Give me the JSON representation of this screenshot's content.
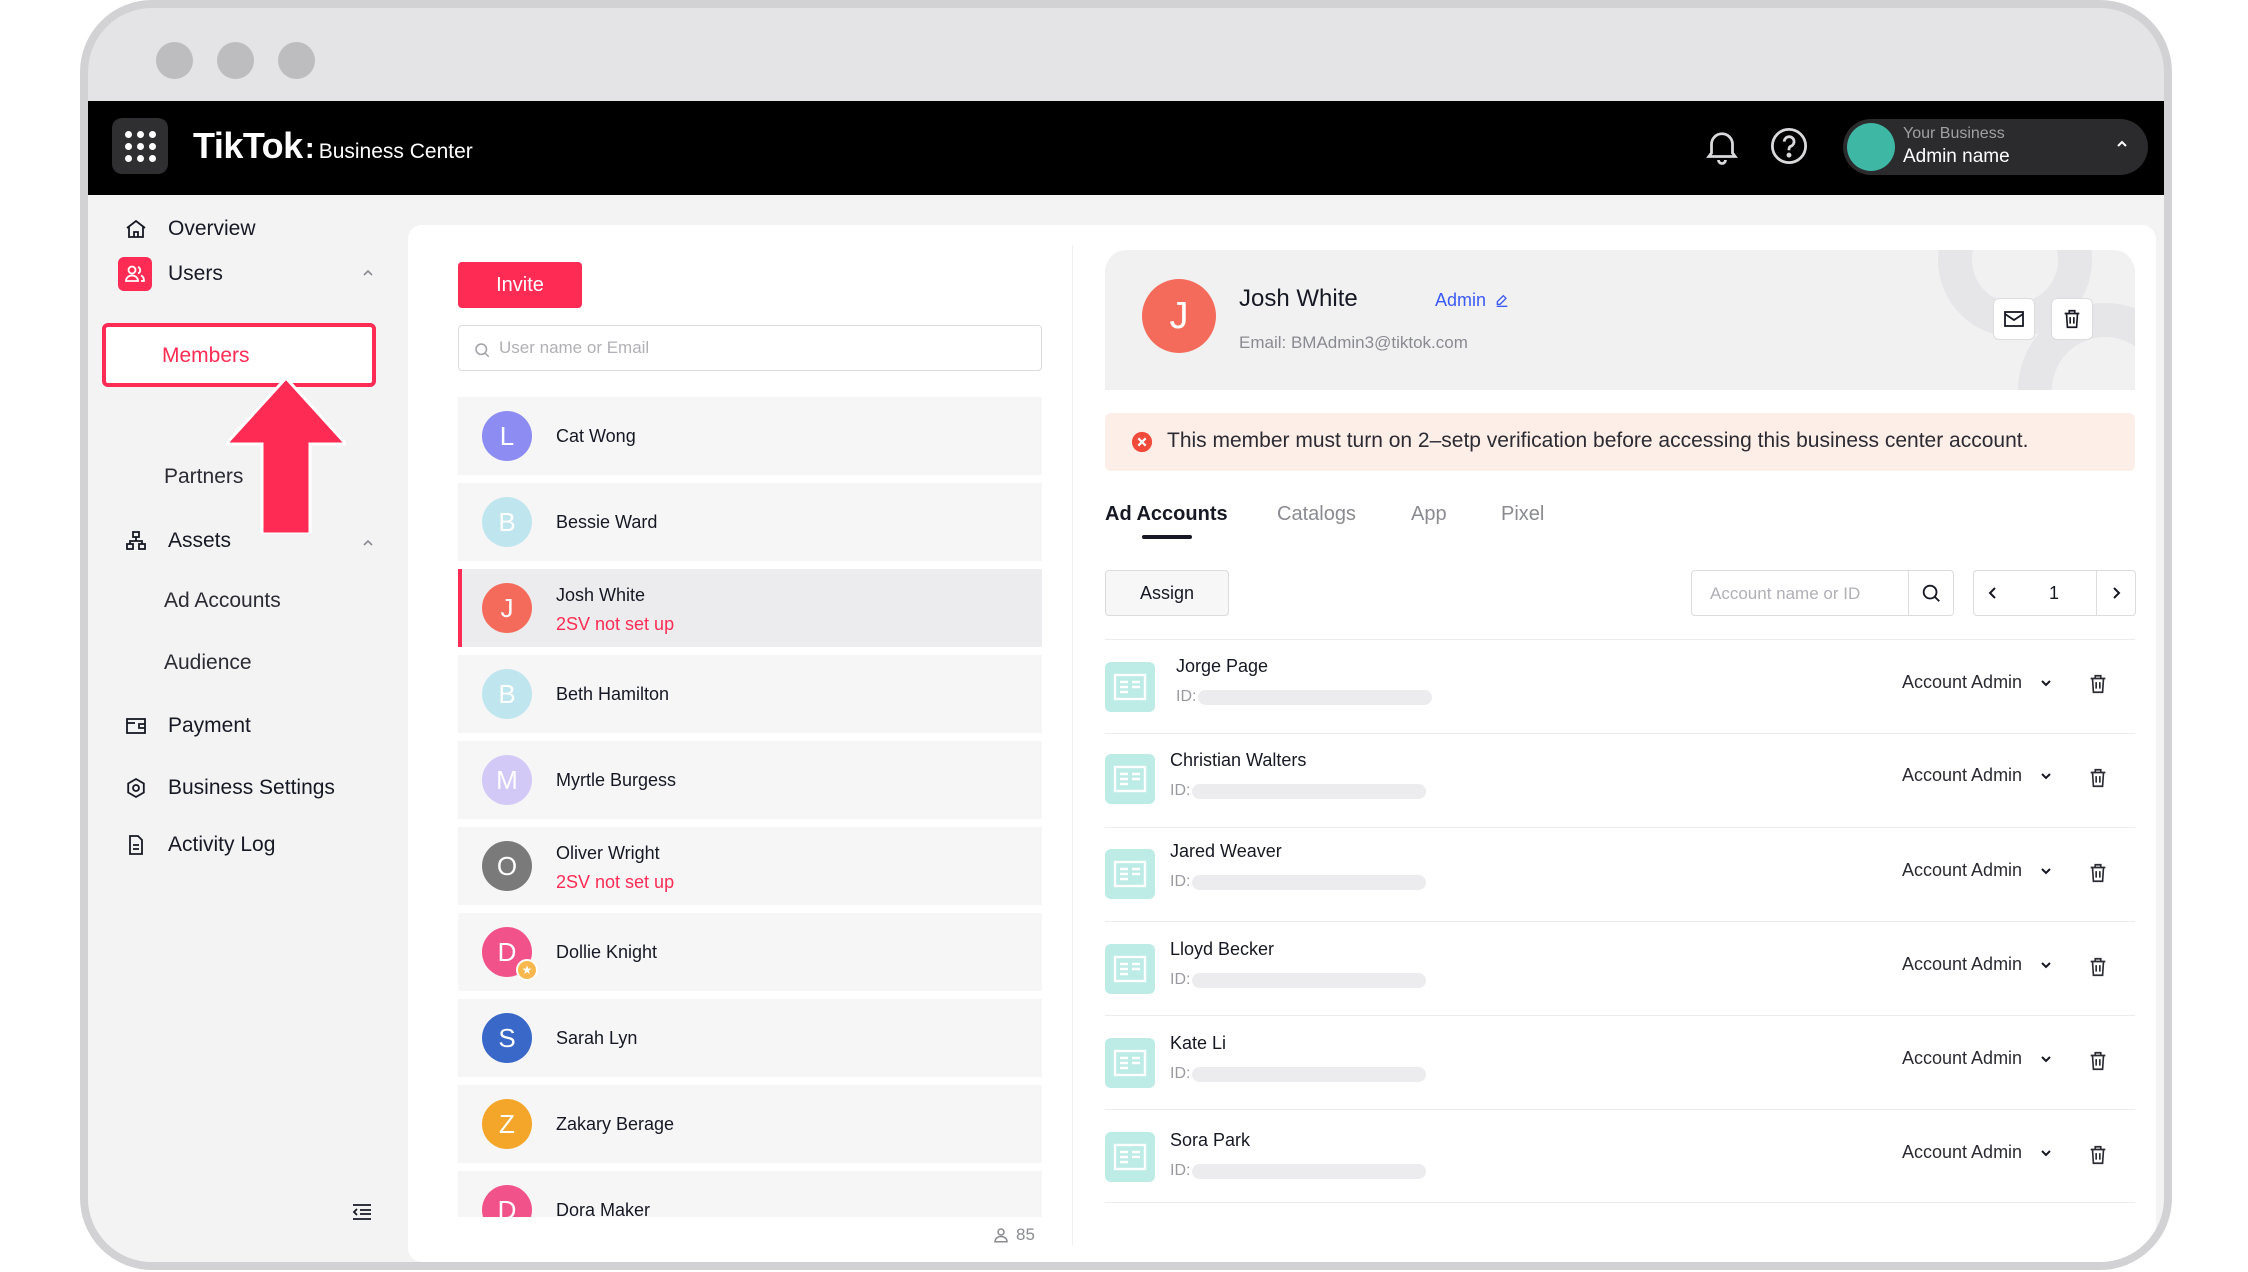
{
  "header": {
    "brand": "TikTok",
    "brand_sub": "Business Center",
    "account": {
      "business": "Your Business",
      "name": "Admin name"
    }
  },
  "sidebar": {
    "items": [
      {
        "label": "Overview",
        "icon": "home-icon"
      },
      {
        "label": "Users",
        "icon": "users-icon"
      },
      {
        "label": "Members"
      },
      {
        "label": "Partners"
      },
      {
        "label": "Assets",
        "icon": "assets-icon"
      },
      {
        "label": "Ad Accounts"
      },
      {
        "label": "Audience"
      },
      {
        "label": "Payment",
        "icon": "payment-icon"
      },
      {
        "label": "Business Settings",
        "icon": "settings-icon"
      },
      {
        "label": "Activity Log",
        "icon": "document-icon"
      }
    ]
  },
  "members": {
    "invite_label": "Invite",
    "search_placeholder": "User name or Email",
    "count": "85",
    "list": [
      {
        "initial": "L",
        "name": "Cat Wong",
        "status": "",
        "color": "#8c8cf2"
      },
      {
        "initial": "B",
        "name": "Bessie Ward",
        "status": "",
        "color": "#bfe6ee"
      },
      {
        "initial": "J",
        "name": "Josh White",
        "status": "2SV not set up",
        "color": "#f56b5b"
      },
      {
        "initial": "B",
        "name": "Beth Hamilton",
        "status": "",
        "color": "#bfe6ee"
      },
      {
        "initial": "M",
        "name": "Myrtle Burgess",
        "status": "",
        "color": "#d3c9f7"
      },
      {
        "initial": "O",
        "name": "Oliver Wright",
        "status": "2SV not set up",
        "color": "#7a7a7a"
      },
      {
        "initial": "D",
        "name": "Dollie Knight",
        "status": "",
        "color": "#f2528a"
      },
      {
        "initial": "S",
        "name": "Sarah Lyn",
        "status": "",
        "color": "#3968c8"
      },
      {
        "initial": "Z",
        "name": "Zakary Berage",
        "status": "",
        "color": "#f4a62a"
      },
      {
        "initial": "D",
        "name": "Dora Maker",
        "status": "",
        "color": "#f2528a"
      }
    ]
  },
  "detail": {
    "initial": "J",
    "name": "Josh White",
    "role": "Admin",
    "email": "Email: BMAdmin3@tiktok.com",
    "alert": "This member must turn on 2–setp verification before accessing this business center account.",
    "tabs": [
      "Ad Accounts",
      "Catalogs",
      "App",
      "Pixel"
    ],
    "assign_label": "Assign",
    "account_search_placeholder": "Account name or ID",
    "page": "1",
    "id_label": "ID:",
    "accounts": [
      {
        "name": "Jorge Page",
        "role": "Account Admin"
      },
      {
        "name": "Christian Walters",
        "role": "Account Admin"
      },
      {
        "name": "Jared Weaver",
        "role": "Account Admin"
      },
      {
        "name": "Lloyd Becker",
        "role": "Account Admin"
      },
      {
        "name": "Kate Li",
        "role": "Account Admin"
      },
      {
        "name": "Sora Park",
        "role": "Account Admin"
      }
    ]
  },
  "colors": {
    "accent": "#fe2c55",
    "link": "#3b5af5",
    "alert_bg": "#fdeee8"
  }
}
